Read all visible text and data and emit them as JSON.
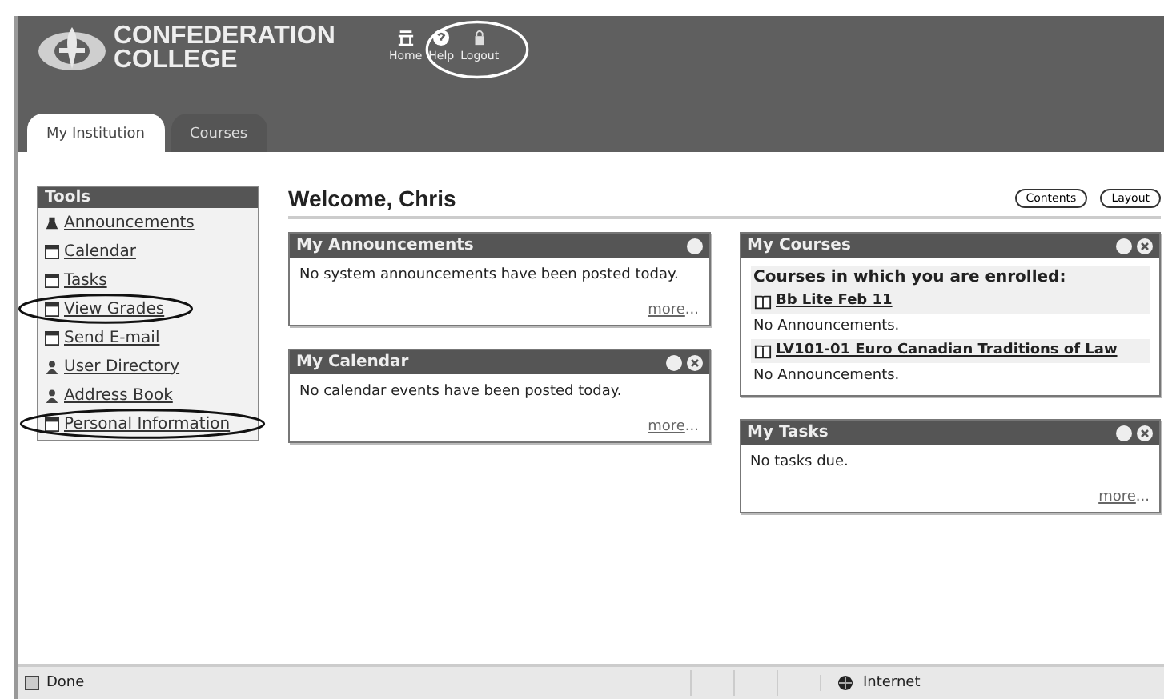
{
  "header": {
    "logo_line1": "CONFEDERATION",
    "logo_line2": "COLLEGE",
    "links_circled": true,
    "links": [
      {
        "kind": "home",
        "label": "Home"
      },
      {
        "kind": "help",
        "label": "Help"
      },
      {
        "kind": "logout",
        "label": "Logout"
      }
    ]
  },
  "tabs": [
    {
      "label": "My Institution",
      "selected": true
    },
    {
      "label": "Courses",
      "selected": false
    }
  ],
  "tools": {
    "title": "Tools",
    "items": [
      {
        "kind": "announce",
        "label": "Announcements",
        "circled": false
      },
      {
        "kind": "calendar",
        "label": "Calendar",
        "circled": false
      },
      {
        "kind": "tasks",
        "label": "Tasks",
        "circled": false
      },
      {
        "kind": "grades",
        "label": "View Grades",
        "circled": true
      },
      {
        "kind": "mail",
        "label": "Send E-mail",
        "circled": false
      },
      {
        "kind": "users",
        "label": "User Directory",
        "circled": false
      },
      {
        "kind": "book",
        "label": "Address Book",
        "circled": false
      },
      {
        "kind": "info",
        "label": "Personal Information",
        "circled": true
      }
    ]
  },
  "welcome": "Welcome, Chris",
  "buttons": [
    "Contents",
    "Layout"
  ],
  "left_modules": [
    {
      "title": "My Announcements",
      "closable": false,
      "text": "No system announcements have been posted today.",
      "more": "more",
      "ellipsis": "..."
    },
    {
      "title": "My Calendar",
      "closable": true,
      "text": "No calendar events have been posted today.",
      "more": "more",
      "ellipsis": "..."
    }
  ],
  "courses_module": {
    "title": "My Courses",
    "closable": true,
    "heading": "Courses in which you are enrolled:",
    "courses": [
      {
        "name": "Bb Lite Feb 11",
        "note": "No Announcements."
      },
      {
        "name": "LV101-01 Euro Canadian Traditions of Law",
        "note": "No Announcements."
      }
    ]
  },
  "tasks_module": {
    "title": "My Tasks",
    "closable": true,
    "text": "No tasks due.",
    "more": "more",
    "ellipsis": "..."
  },
  "status_bar": {
    "status": "Done",
    "zone": "Internet"
  }
}
